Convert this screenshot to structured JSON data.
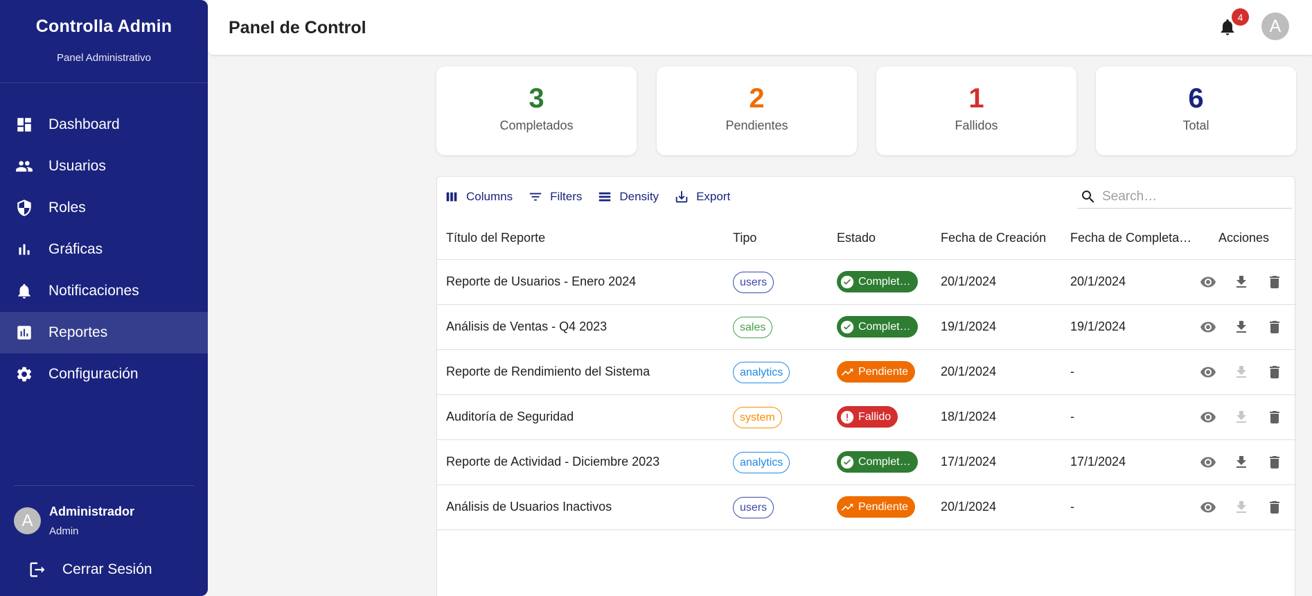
{
  "sidebar": {
    "brand_title": "Controlla Admin",
    "brand_subtitle": "Panel Administrativo",
    "items": [
      {
        "label": "Dashboard",
        "icon": "dashboard-icon"
      },
      {
        "label": "Usuarios",
        "icon": "people-icon"
      },
      {
        "label": "Roles",
        "icon": "shield-icon"
      },
      {
        "label": "Gráficas",
        "icon": "bar-chart-icon"
      },
      {
        "label": "Notificaciones",
        "icon": "bell-icon"
      },
      {
        "label": "Reportes",
        "icon": "report-icon",
        "active": true
      },
      {
        "label": "Configuración",
        "icon": "gear-icon"
      }
    ],
    "user": {
      "avatar_letter": "A",
      "name": "Administrador",
      "role": "Admin"
    },
    "logout_label": "Cerrar Sesión",
    "color": "#1a237e"
  },
  "header": {
    "title": "Panel de Control",
    "notification_count": "4",
    "avatar_letter": "A"
  },
  "stats": [
    {
      "value": "3",
      "label": "Completados",
      "color": "#2e7d32"
    },
    {
      "value": "2",
      "label": "Pendientes",
      "color": "#ef6c00"
    },
    {
      "value": "1",
      "label": "Fallidos",
      "color": "#d32f2f"
    },
    {
      "value": "6",
      "label": "Total",
      "color": "#1a237e"
    }
  ],
  "toolbar": {
    "columns": "Columns",
    "filters": "Filters",
    "density": "Density",
    "export": "Export",
    "search_placeholder": "Search…"
  },
  "table": {
    "headers": [
      "Título del Reporte",
      "Tipo",
      "Estado",
      "Fecha de Creación",
      "Fecha de Completa…",
      "Acciones"
    ],
    "rows": [
      {
        "title": "Reporte de Usuarios - Enero 2024",
        "type": "users",
        "status": "Complet…",
        "created": "20/1/2024",
        "completed": "20/1/2024"
      },
      {
        "title": "Análisis de Ventas - Q4 2023",
        "type": "sales",
        "status": "Complet…",
        "created": "19/1/2024",
        "completed": "19/1/2024"
      },
      {
        "title": "Reporte de Rendimiento del Sistema",
        "type": "analytics",
        "status": "Pendiente",
        "created": "20/1/2024",
        "completed": "-"
      },
      {
        "title": "Auditoría de Seguridad",
        "type": "system",
        "status": "Fallido",
        "created": "18/1/2024",
        "completed": "-"
      },
      {
        "title": "Reporte de Actividad - Diciembre 2023",
        "type": "analytics",
        "status": "Complet…",
        "created": "17/1/2024",
        "completed": "17/1/2024"
      },
      {
        "title": "Análisis de Usuarios Inactivos",
        "type": "users",
        "status": "Pendiente",
        "created": "20/1/2024",
        "completed": "-"
      }
    ]
  },
  "colors": {
    "type_users": "#3949ab",
    "type_sales": "#43a047",
    "type_analytics": "#1e88e5",
    "type_system": "#fb8c00",
    "status_completed": "#2e7d32",
    "status_pending": "#ef6c00",
    "status_failed": "#d32f2f"
  }
}
